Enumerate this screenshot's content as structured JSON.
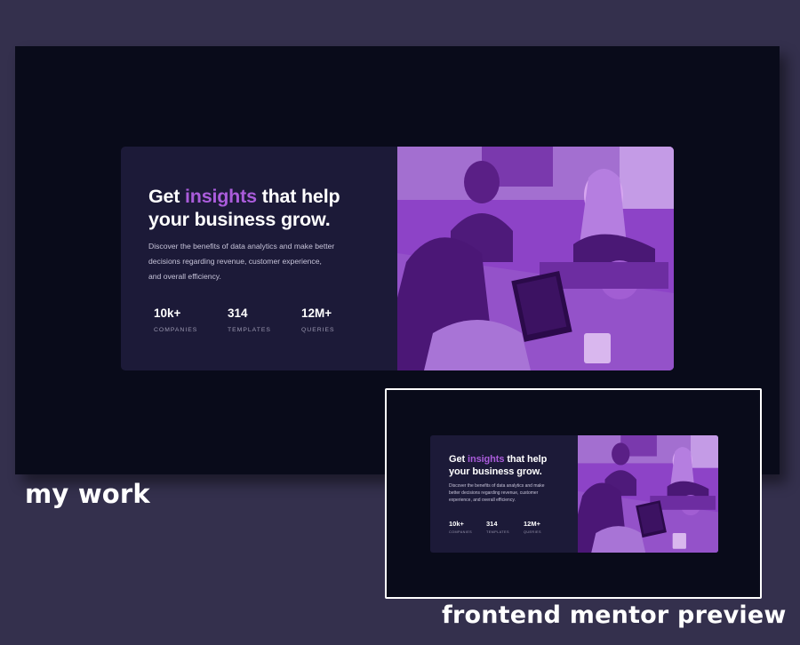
{
  "card": {
    "title_pre": "Get ",
    "title_accent": "insights",
    "title_post": " that help your business grow.",
    "description": "Discover the benefits of data analytics and make better decisions regarding revenue, customer experience, and overall efficiency.",
    "stats": [
      {
        "value": "10k+",
        "label": "COMPANIES"
      },
      {
        "value": "314",
        "label": "TEMPLATES"
      },
      {
        "value": "12M+",
        "label": "QUERIES"
      }
    ],
    "image": "office-photo-purple-overlay"
  },
  "preview_card": {
    "title_pre": "Get ",
    "title_accent": "insights",
    "title_post": " that help your business grow.",
    "description": "Discover the benefits of data analytics and make better decisions regarding revenue, customer experience, and overall efficiency.",
    "stats": [
      {
        "value": "10k+",
        "label": "COMPANIES"
      },
      {
        "value": "314",
        "label": "TEMPLATES"
      },
      {
        "value": "12M+",
        "label": "QUERIES"
      }
    ]
  },
  "captions": {
    "my_work": "my work",
    "preview": "frontend mentor preview"
  },
  "colors": {
    "background": "#34304d",
    "screen": "#090b1a",
    "card": "#1c1a38",
    "accent": "#aa5cdb",
    "image_overlay": "#8d43c7"
  }
}
